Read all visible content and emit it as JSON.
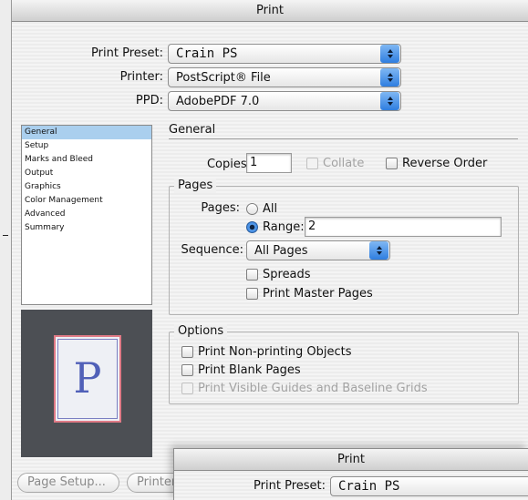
{
  "window": {
    "title": "Print"
  },
  "top_form": {
    "print_preset": {
      "label": "Print Preset:",
      "value": "Crain PS"
    },
    "printer": {
      "label": "Printer:",
      "value": "PostScript® File"
    },
    "ppd": {
      "label": "PPD:",
      "value": "AdobePDF 7.0"
    }
  },
  "sidebar": {
    "items": [
      {
        "label": "General",
        "selected": true
      },
      {
        "label": "Setup"
      },
      {
        "label": "Marks and Bleed"
      },
      {
        "label": "Output"
      },
      {
        "label": "Graphics"
      },
      {
        "label": "Color Management"
      },
      {
        "label": "Advanced"
      },
      {
        "label": "Summary"
      }
    ]
  },
  "preview": {
    "letter": "P"
  },
  "general": {
    "title": "General",
    "copies_label": "Copies:",
    "copies_value": "1",
    "collate_label": "Collate",
    "reverse_order_label": "Reverse Order"
  },
  "pages_group": {
    "title": "Pages",
    "pages_label": "Pages:",
    "all_label": "All",
    "range_label": "Range:",
    "range_value": "2",
    "sequence_label": "Sequence:",
    "sequence_value": "All Pages",
    "spreads_label": "Spreads",
    "print_master_pages_label": "Print Master Pages"
  },
  "options_group": {
    "title": "Options",
    "non_printing_label": "Print Non-printing Objects",
    "blank_pages_label": "Print Blank Pages",
    "guides_label": "Print Visible Guides and Baseline Grids"
  },
  "buttons": {
    "page_setup": "Page Setup...",
    "printer": "Printer..."
  },
  "sub_window": {
    "title": "Print",
    "print_preset_label": "Print Preset:",
    "print_preset_value": "Crain PS"
  }
}
